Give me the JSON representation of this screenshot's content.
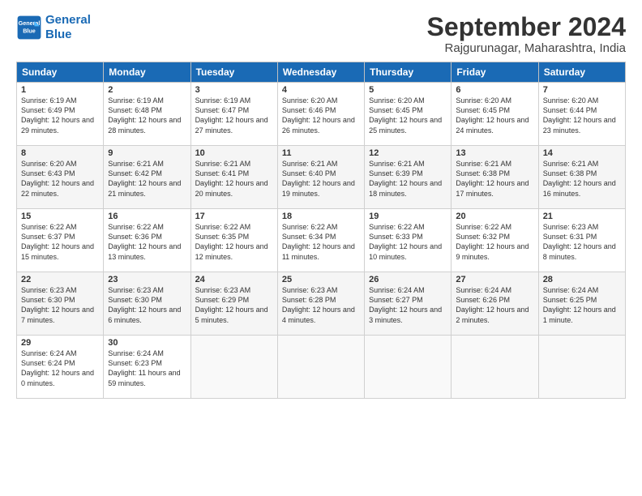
{
  "header": {
    "logo_line1": "General",
    "logo_line2": "Blue",
    "month": "September 2024",
    "location": "Rajgurunagar, Maharashtra, India"
  },
  "weekdays": [
    "Sunday",
    "Monday",
    "Tuesday",
    "Wednesday",
    "Thursday",
    "Friday",
    "Saturday"
  ],
  "weeks": [
    [
      {
        "day": "1",
        "sunrise": "6:19 AM",
        "sunset": "6:49 PM",
        "daylight": "12 hours and 29 minutes."
      },
      {
        "day": "2",
        "sunrise": "6:19 AM",
        "sunset": "6:48 PM",
        "daylight": "12 hours and 28 minutes."
      },
      {
        "day": "3",
        "sunrise": "6:19 AM",
        "sunset": "6:47 PM",
        "daylight": "12 hours and 27 minutes."
      },
      {
        "day": "4",
        "sunrise": "6:20 AM",
        "sunset": "6:46 PM",
        "daylight": "12 hours and 26 minutes."
      },
      {
        "day": "5",
        "sunrise": "6:20 AM",
        "sunset": "6:45 PM",
        "daylight": "12 hours and 25 minutes."
      },
      {
        "day": "6",
        "sunrise": "6:20 AM",
        "sunset": "6:45 PM",
        "daylight": "12 hours and 24 minutes."
      },
      {
        "day": "7",
        "sunrise": "6:20 AM",
        "sunset": "6:44 PM",
        "daylight": "12 hours and 23 minutes."
      }
    ],
    [
      {
        "day": "8",
        "sunrise": "6:20 AM",
        "sunset": "6:43 PM",
        "daylight": "12 hours and 22 minutes."
      },
      {
        "day": "9",
        "sunrise": "6:21 AM",
        "sunset": "6:42 PM",
        "daylight": "12 hours and 21 minutes."
      },
      {
        "day": "10",
        "sunrise": "6:21 AM",
        "sunset": "6:41 PM",
        "daylight": "12 hours and 20 minutes."
      },
      {
        "day": "11",
        "sunrise": "6:21 AM",
        "sunset": "6:40 PM",
        "daylight": "12 hours and 19 minutes."
      },
      {
        "day": "12",
        "sunrise": "6:21 AM",
        "sunset": "6:39 PM",
        "daylight": "12 hours and 18 minutes."
      },
      {
        "day": "13",
        "sunrise": "6:21 AM",
        "sunset": "6:38 PM",
        "daylight": "12 hours and 17 minutes."
      },
      {
        "day": "14",
        "sunrise": "6:21 AM",
        "sunset": "6:38 PM",
        "daylight": "12 hours and 16 minutes."
      }
    ],
    [
      {
        "day": "15",
        "sunrise": "6:22 AM",
        "sunset": "6:37 PM",
        "daylight": "12 hours and 15 minutes."
      },
      {
        "day": "16",
        "sunrise": "6:22 AM",
        "sunset": "6:36 PM",
        "daylight": "12 hours and 13 minutes."
      },
      {
        "day": "17",
        "sunrise": "6:22 AM",
        "sunset": "6:35 PM",
        "daylight": "12 hours and 12 minutes."
      },
      {
        "day": "18",
        "sunrise": "6:22 AM",
        "sunset": "6:34 PM",
        "daylight": "12 hours and 11 minutes."
      },
      {
        "day": "19",
        "sunrise": "6:22 AM",
        "sunset": "6:33 PM",
        "daylight": "12 hours and 10 minutes."
      },
      {
        "day": "20",
        "sunrise": "6:22 AM",
        "sunset": "6:32 PM",
        "daylight": "12 hours and 9 minutes."
      },
      {
        "day": "21",
        "sunrise": "6:23 AM",
        "sunset": "6:31 PM",
        "daylight": "12 hours and 8 minutes."
      }
    ],
    [
      {
        "day": "22",
        "sunrise": "6:23 AM",
        "sunset": "6:30 PM",
        "daylight": "12 hours and 7 minutes."
      },
      {
        "day": "23",
        "sunrise": "6:23 AM",
        "sunset": "6:30 PM",
        "daylight": "12 hours and 6 minutes."
      },
      {
        "day": "24",
        "sunrise": "6:23 AM",
        "sunset": "6:29 PM",
        "daylight": "12 hours and 5 minutes."
      },
      {
        "day": "25",
        "sunrise": "6:23 AM",
        "sunset": "6:28 PM",
        "daylight": "12 hours and 4 minutes."
      },
      {
        "day": "26",
        "sunrise": "6:24 AM",
        "sunset": "6:27 PM",
        "daylight": "12 hours and 3 minutes."
      },
      {
        "day": "27",
        "sunrise": "6:24 AM",
        "sunset": "6:26 PM",
        "daylight": "12 hours and 2 minutes."
      },
      {
        "day": "28",
        "sunrise": "6:24 AM",
        "sunset": "6:25 PM",
        "daylight": "12 hours and 1 minute."
      }
    ],
    [
      {
        "day": "29",
        "sunrise": "6:24 AM",
        "sunset": "6:24 PM",
        "daylight": "12 hours and 0 minutes."
      },
      {
        "day": "30",
        "sunrise": "6:24 AM",
        "sunset": "6:23 PM",
        "daylight": "11 hours and 59 minutes."
      },
      null,
      null,
      null,
      null,
      null
    ]
  ]
}
